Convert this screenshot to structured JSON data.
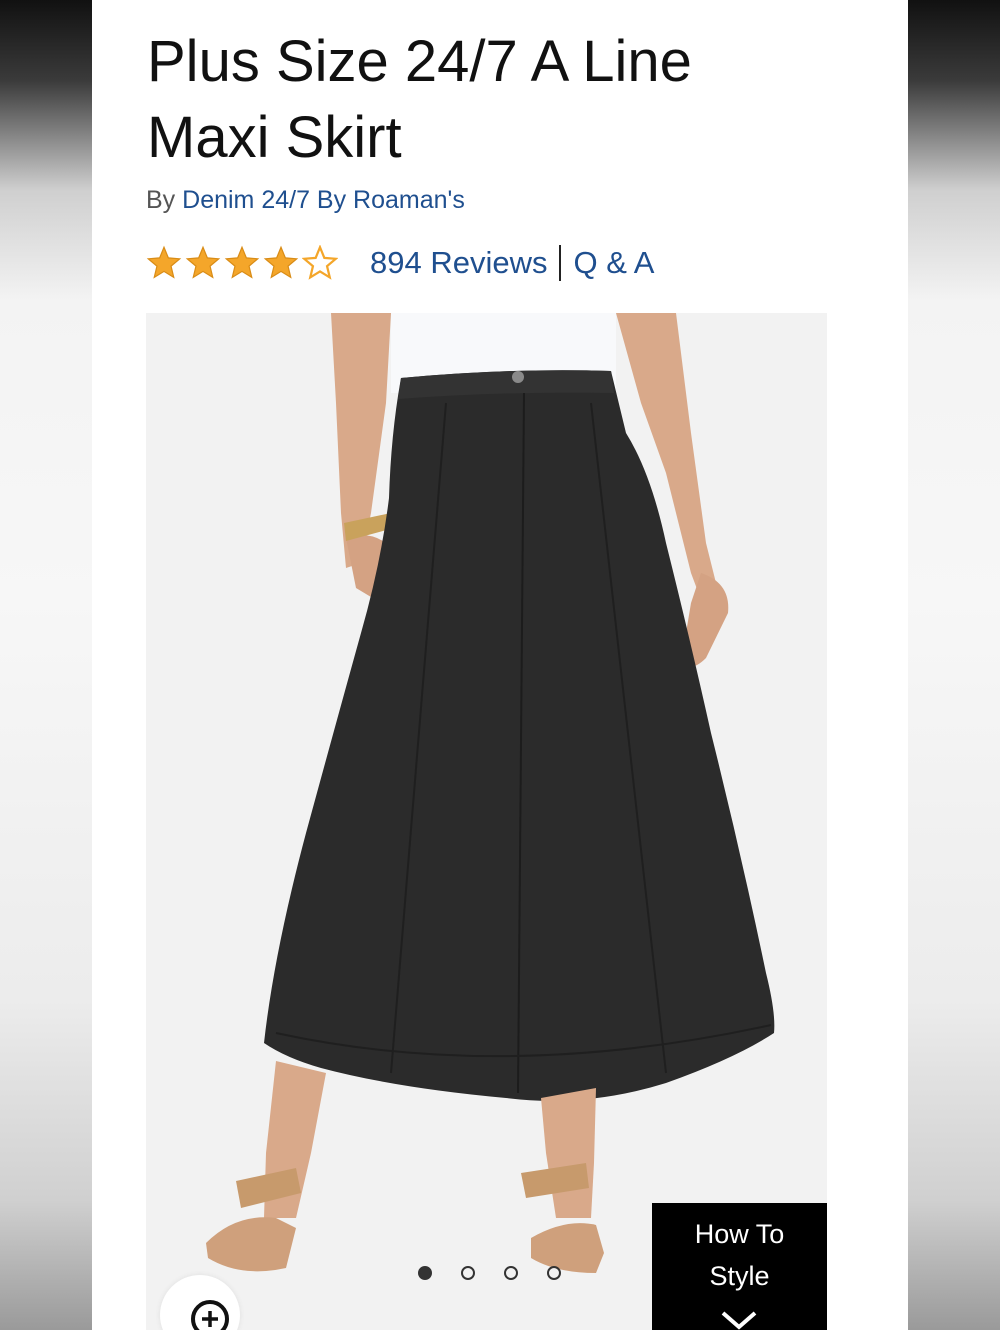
{
  "product": {
    "title": "Plus Size 24/7 A Line Maxi Skirt",
    "by_prefix": "By",
    "brand": "Denim 24/7 By Roaman's",
    "rating": 4,
    "rating_max": 5,
    "reviews_label": "894 Reviews",
    "qa_label": "Q & A"
  },
  "gallery": {
    "image_count": 4,
    "active_index": 0,
    "how_to_style_line1": "How To",
    "how_to_style_line2": "Style"
  },
  "colors": {
    "link": "#1f4f8f",
    "star": "#f4a62a",
    "skirt": "#2b2b2b"
  },
  "icons": {
    "zoom": "zoom-in-icon",
    "chevron": "chevron-down-icon",
    "star": "star-icon"
  }
}
